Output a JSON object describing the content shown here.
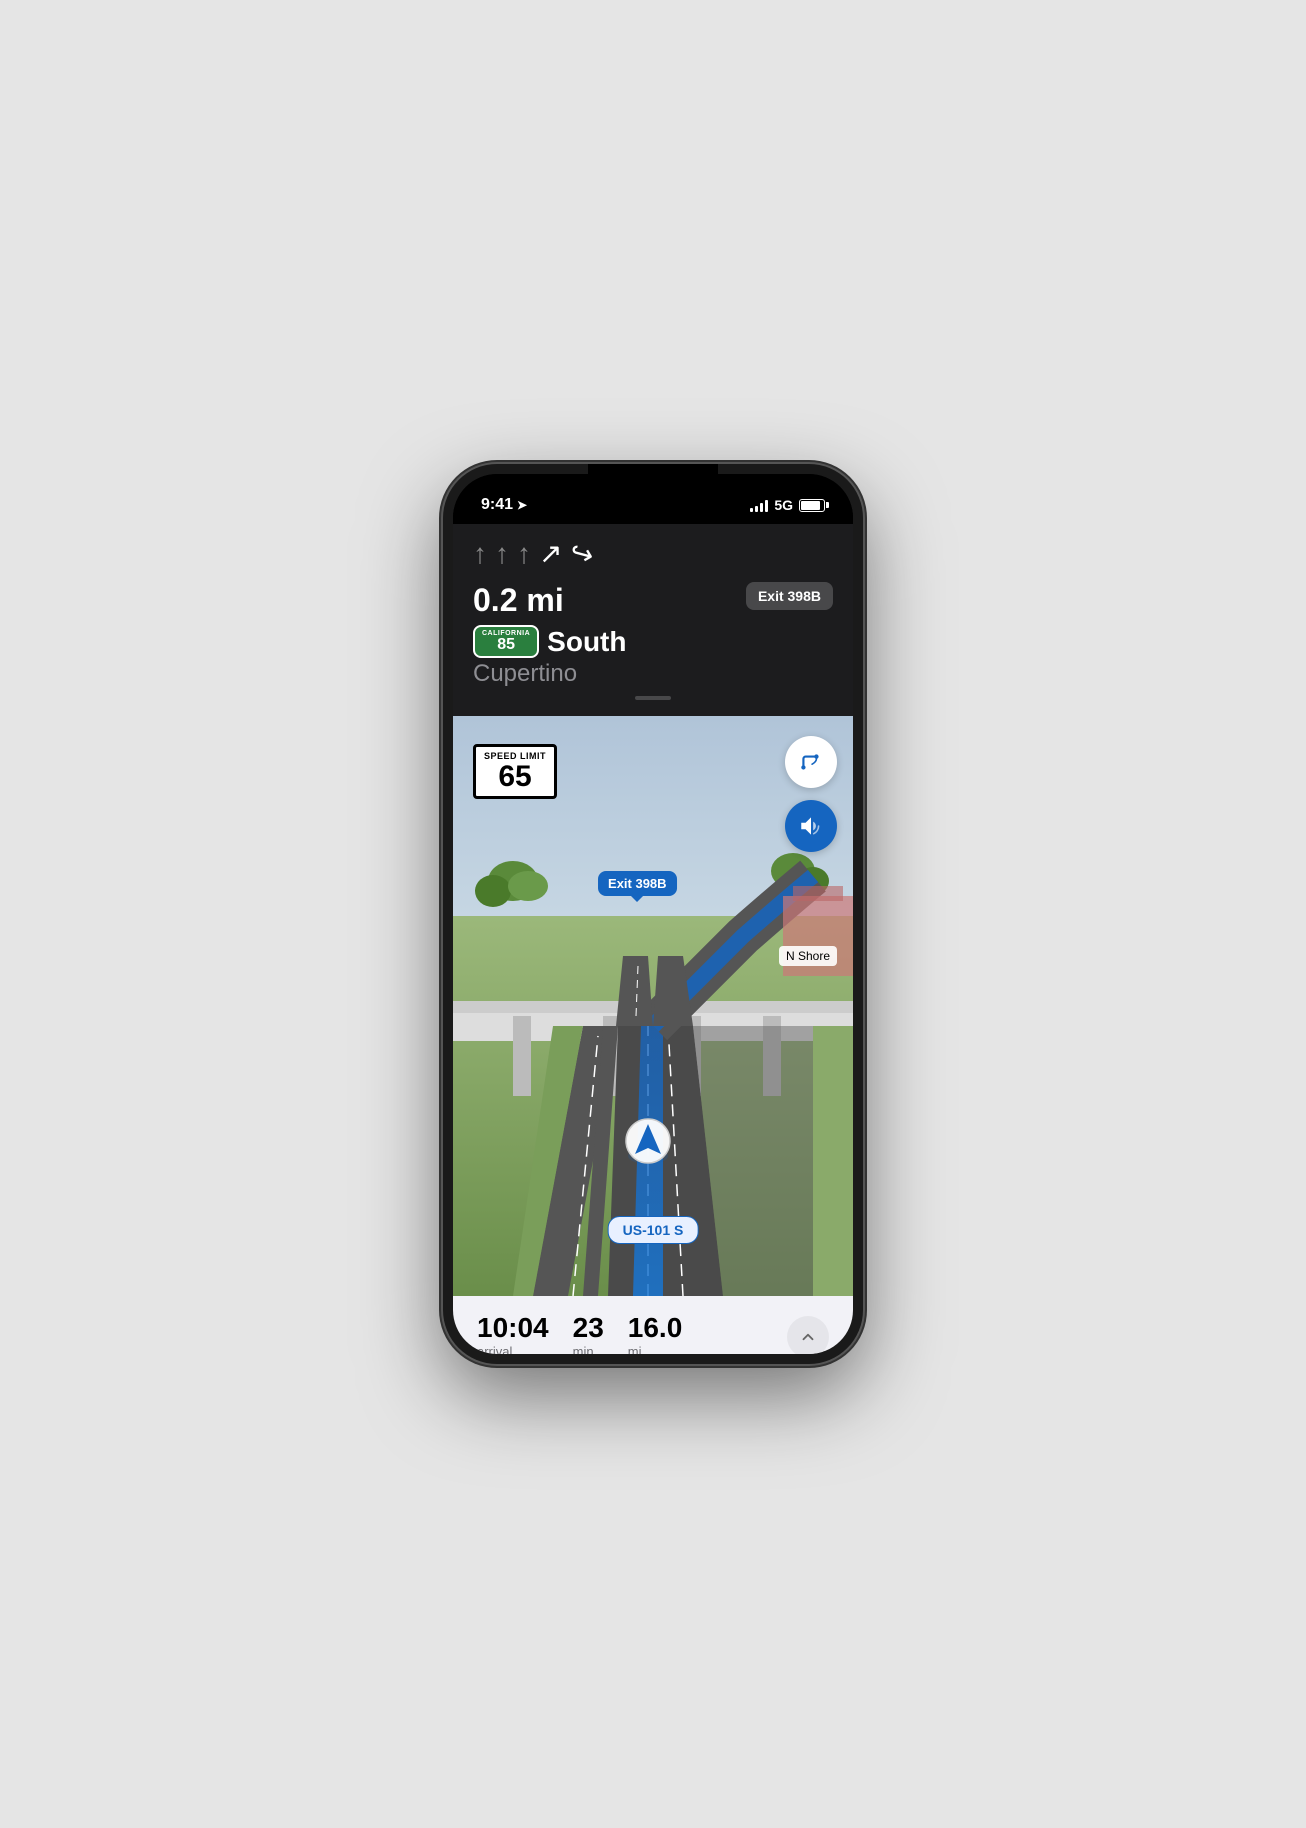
{
  "phone": {
    "status_bar": {
      "time": "9:41",
      "signal_bars": 4,
      "network": "5G",
      "battery_percent": 85
    },
    "nav_header": {
      "distance": "0.2 mi",
      "exit_badge": "Exit 398B",
      "route_badge_state": "CALIFORNIA",
      "route_badge_number": "85",
      "route_direction": "South",
      "route_destination": "Cupertino",
      "lane_arrows": [
        "straight",
        "straight",
        "straight",
        "bear-right-active",
        "turn-right-active"
      ]
    },
    "map": {
      "speed_limit_label_top": "SPEED LIMIT",
      "speed_limit_number": "65",
      "exit_label": "Exit 398B",
      "n_shore_label": "N Shore",
      "route_label": "US-101 S"
    },
    "bottom_panel": {
      "arrival_time": "10:04",
      "arrival_label": "arrival",
      "minutes": "23",
      "minutes_label": "min",
      "distance": "16.0",
      "distance_label": "mi"
    }
  }
}
